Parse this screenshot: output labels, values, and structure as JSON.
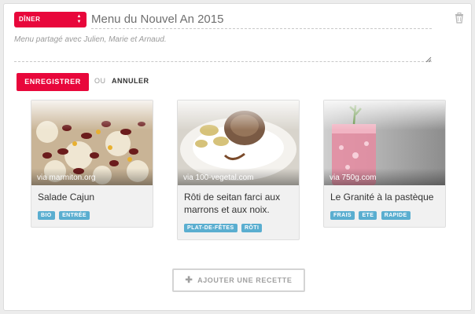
{
  "meal_select": {
    "value": "DÎNER",
    "icon": "sort-arrows-icon"
  },
  "menu": {
    "title": "Menu du Nouvel An 2015",
    "description": "Menu partagé avec Julien, Marie et Arnaud."
  },
  "actions": {
    "save_label": "ENREGISTRER",
    "or_label": "OU",
    "cancel_label": "ANNULER",
    "add_recipe_label": "AJOUTER UNE RECETTE",
    "delete_icon": "trash-icon"
  },
  "recipes": [
    {
      "source": "via marmiton.org",
      "name": "Salade Cajun",
      "tags": [
        "BIO",
        "ENTRÉE"
      ]
    },
    {
      "source": "via 100-vegetal.com",
      "name": "Rôti de seitan farci aux marrons et aux noix.",
      "tags": [
        "PLAT-DE-FÊTES",
        "RÔTI"
      ]
    },
    {
      "source": "via 750g.com",
      "name": "Le Granité à la pastèque",
      "tags": [
        "FRAIS",
        "ETE",
        "RAPIDE"
      ]
    }
  ],
  "colors": {
    "accent": "#e8073b",
    "tag": "#5aaed0"
  }
}
